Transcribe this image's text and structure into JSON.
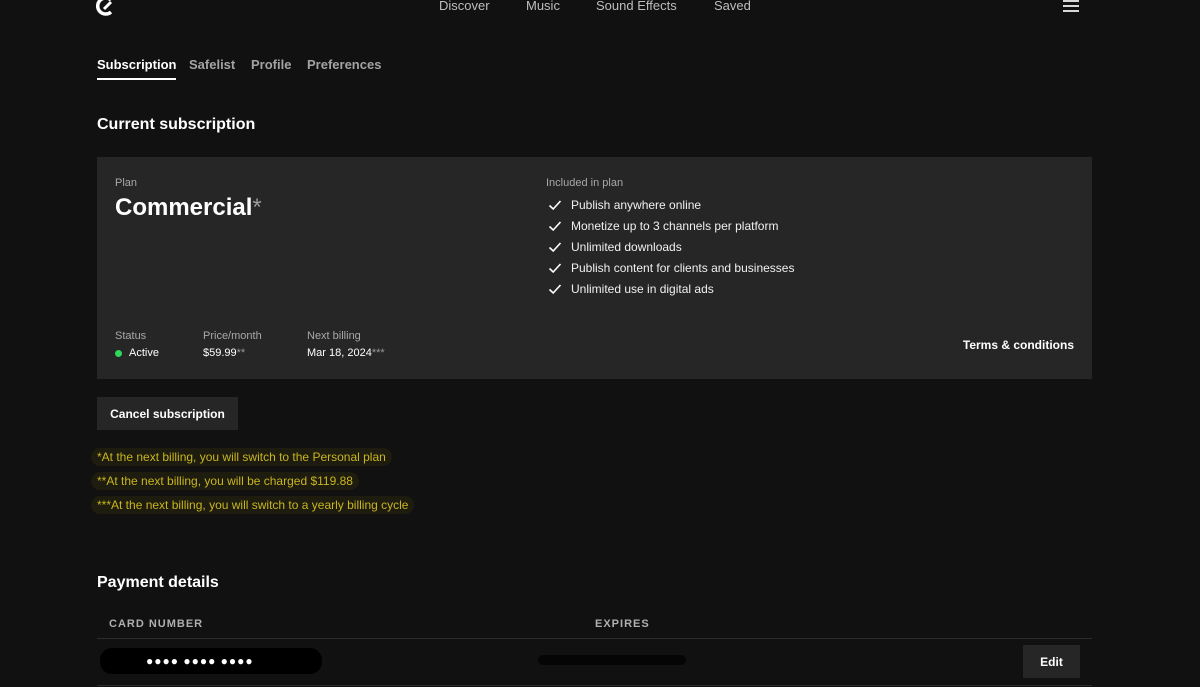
{
  "nav": {
    "logo_icon": "brand-logo-icon",
    "links": [
      "Discover",
      "Music",
      "Sound Effects",
      "Saved"
    ],
    "menu_icon": "hamburger-menu-icon"
  },
  "tabs": [
    {
      "label": "Subscription",
      "active": true
    },
    {
      "label": "Safelist",
      "active": false
    },
    {
      "label": "Profile",
      "active": false
    },
    {
      "label": "Preferences",
      "active": false
    }
  ],
  "current_subscription": {
    "title": "Current subscription",
    "plan_label": "Plan",
    "plan_name": "Commercial",
    "plan_marker": "*",
    "included_label": "Included in plan",
    "features": [
      "Publish anywhere online",
      "Monetize up to 3 channels per platform",
      "Unlimited downloads",
      "Publish content for clients and businesses",
      "Unlimited use in digital ads"
    ],
    "status_label": "Status",
    "status_value": "Active",
    "status_color": "#2fd85d",
    "price_label": "Price/month",
    "price_value": "$59.99",
    "price_marker": "**",
    "billing_label": "Next billing",
    "billing_value": "Mar 18, 2024",
    "billing_marker": "***",
    "terms_link": "Terms & conditions",
    "cancel_button": "Cancel subscription"
  },
  "notes": [
    "*At the next billing, you will switch to the Personal plan",
    "**At the next billing, you will be charged $119.88",
    "***At the next billing, you will switch to a yearly billing cycle"
  ],
  "payment": {
    "title": "Payment details",
    "col_card": "CARD NUMBER",
    "col_expires": "EXPIRES",
    "card_number": "●●●● ●●●● ●●●●",
    "expires": "",
    "edit_button": "Edit"
  },
  "colors": {
    "background": "#111111",
    "card": "#262626",
    "note_text": "#c9b521",
    "status_active": "#2fd85d"
  }
}
